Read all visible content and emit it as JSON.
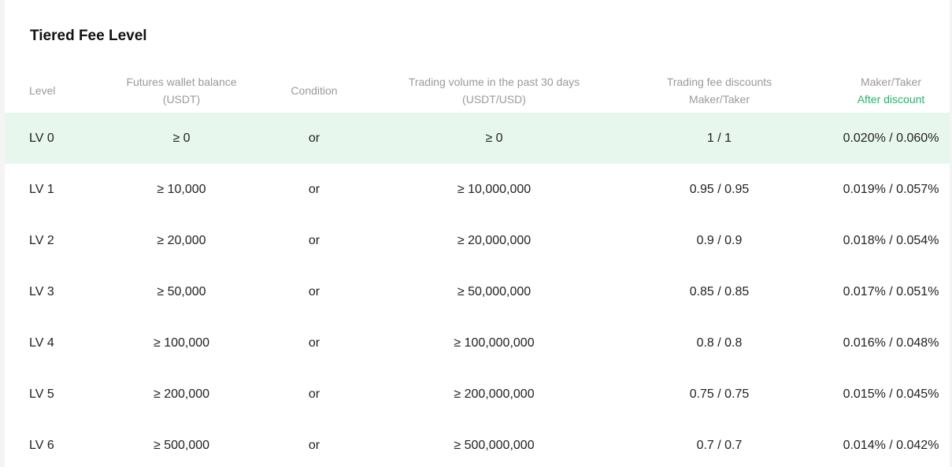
{
  "title": "Tiered Fee Level",
  "headers": {
    "level": "Level",
    "balance_line1": "Futures wallet balance",
    "balance_line2": "(USDT)",
    "condition": "Condition",
    "volume_line1": "Trading volume in the past 30 days",
    "volume_line2": "(USDT/USD)",
    "discount_line1": "Trading fee discounts",
    "discount_line2": "Maker/Taker",
    "fee_line1": "Maker/Taker",
    "fee_line2": "After discount"
  },
  "rows": [
    {
      "level": "LV 0",
      "balance": "≥ 0",
      "condition": "or",
      "volume": "≥ 0",
      "discount": "1 / 1",
      "fee": "0.020% / 0.060%"
    },
    {
      "level": "LV 1",
      "balance": "≥ 10,000",
      "condition": "or",
      "volume": "≥ 10,000,000",
      "discount": "0.95 / 0.95",
      "fee": "0.019% / 0.057%"
    },
    {
      "level": "LV 2",
      "balance": "≥ 20,000",
      "condition": "or",
      "volume": "≥ 20,000,000",
      "discount": "0.9 / 0.9",
      "fee": "0.018% / 0.054%"
    },
    {
      "level": "LV 3",
      "balance": "≥ 50,000",
      "condition": "or",
      "volume": "≥ 50,000,000",
      "discount": "0.85 / 0.85",
      "fee": "0.017% / 0.051%"
    },
    {
      "level": "LV 4",
      "balance": "≥ 100,000",
      "condition": "or",
      "volume": "≥ 100,000,000",
      "discount": "0.8 / 0.8",
      "fee": "0.016% / 0.048%"
    },
    {
      "level": "LV 5",
      "balance": "≥ 200,000",
      "condition": "or",
      "volume": "≥ 200,000,000",
      "discount": "0.75 / 0.75",
      "fee": "0.015% / 0.045%"
    },
    {
      "level": "LV 6",
      "balance": "≥ 500,000",
      "condition": "or",
      "volume": "≥ 500,000,000",
      "discount": "0.7 / 0.7",
      "fee": "0.014% / 0.042%"
    }
  ],
  "colors": {
    "highlight_row": "#e8f7ee",
    "accent_green": "#1eb768",
    "header_text": "#9a9a9a",
    "body_text": "#222222"
  }
}
